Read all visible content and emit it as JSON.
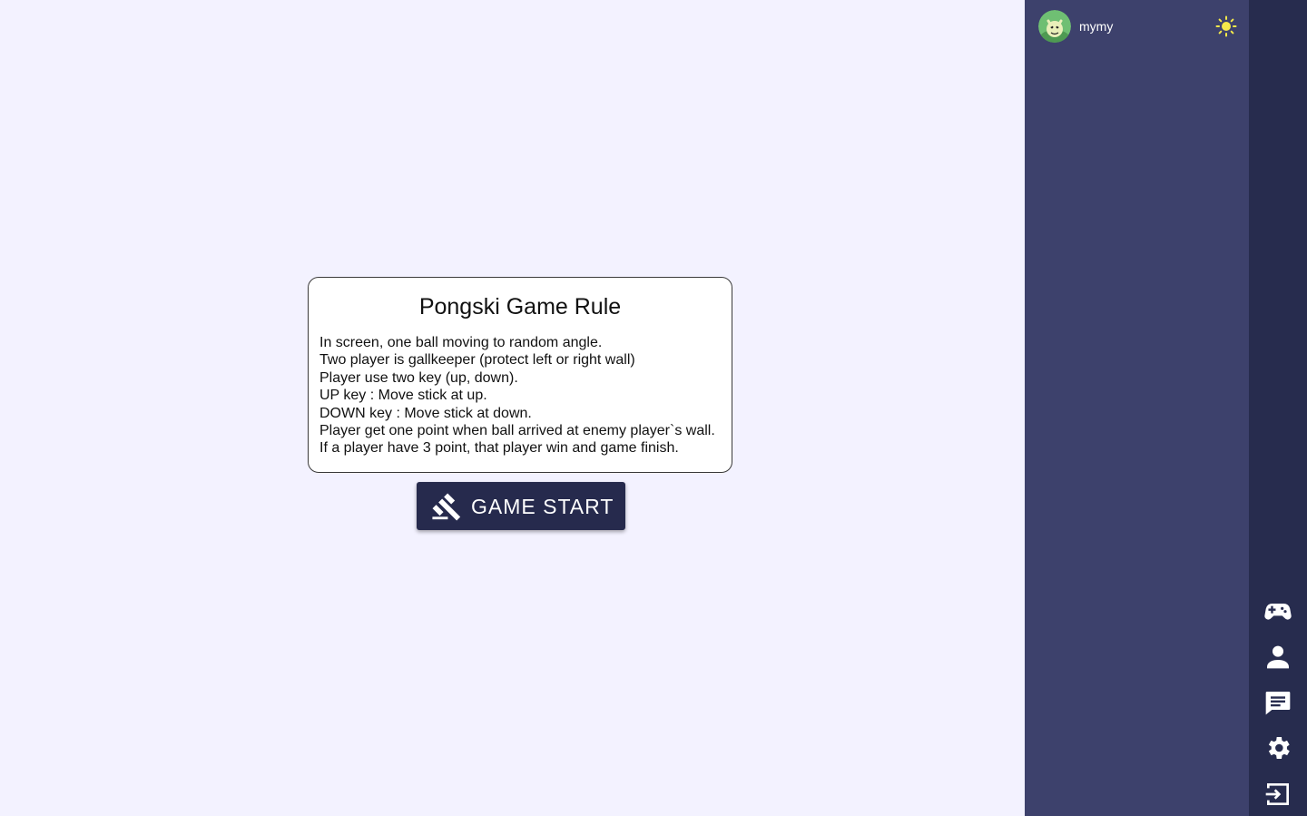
{
  "rules": {
    "title": "Pongski Game Rule",
    "lines": [
      "In screen, one ball moving to random angle.",
      "Two player is gallkeeper (protect left or right wall)",
      "Player use two key (up, down).",
      "UP key : Move stick at up.",
      "DOWN key : Move stick at down.",
      "Player get one point when ball arrived at enemy player`s wall.",
      "If a player have 3 point, that player win and game finish."
    ]
  },
  "start_button": {
    "label": "GAME START",
    "icon": "gavel-icon"
  },
  "side_panel": {
    "username": "mymy",
    "avatar": "avatar-icon",
    "theme_icon": "sun-icon"
  },
  "nav": {
    "items": [
      {
        "icon": "gamepad-icon"
      },
      {
        "icon": "person-icon"
      },
      {
        "icon": "chat-icon"
      },
      {
        "icon": "gear-icon"
      },
      {
        "icon": "logout-icon"
      }
    ]
  },
  "colors": {
    "main_bg": "#f3f2ff",
    "side_panel_bg": "#3d416c",
    "icon_bar_bg": "#272c4e",
    "button_bg": "#262a4d",
    "sun": "#f5e94a"
  }
}
